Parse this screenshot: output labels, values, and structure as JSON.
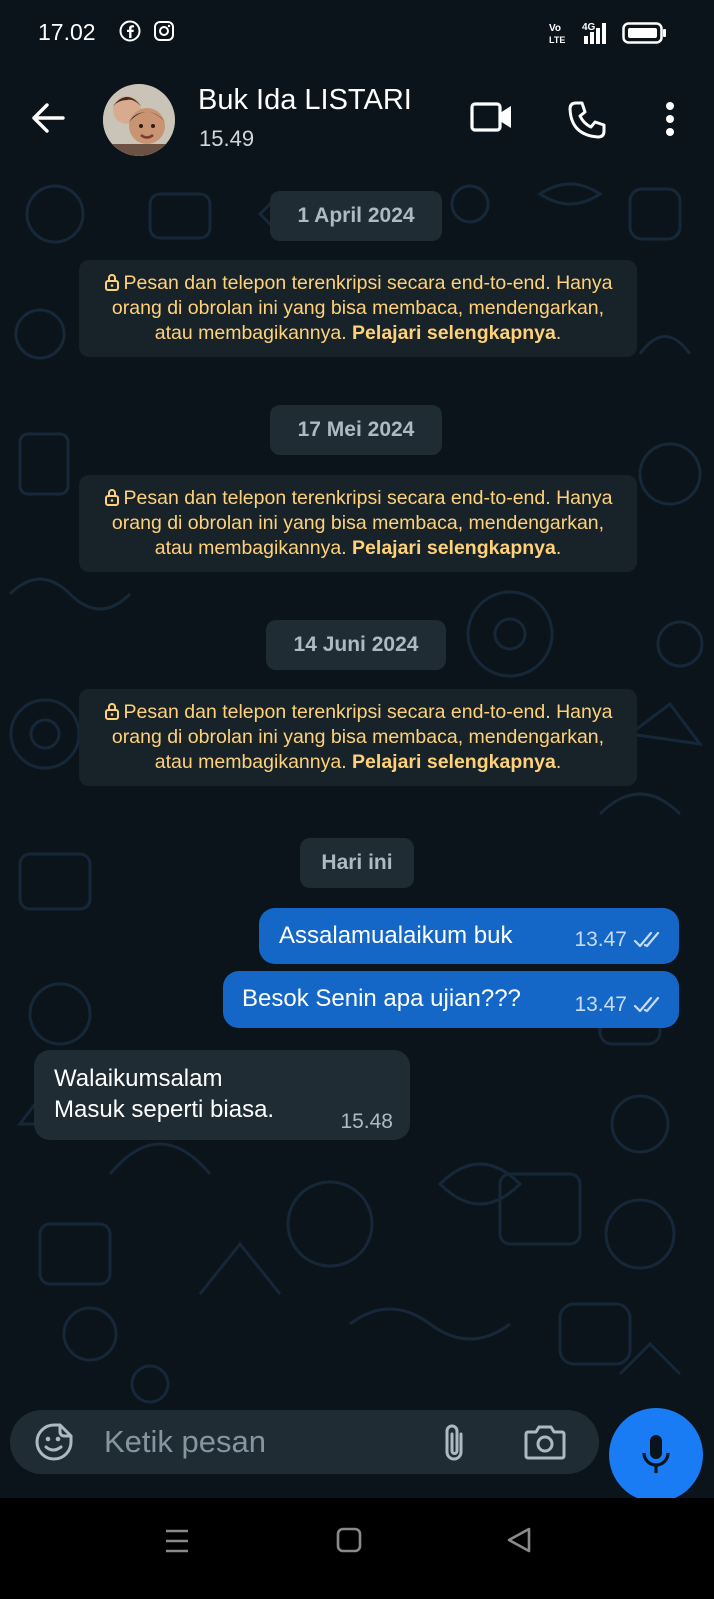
{
  "status_bar": {
    "time": "17.02",
    "icons": [
      "facebook-icon",
      "instagram-icon",
      "volte-icon",
      "signal-4g-icon",
      "battery-icon"
    ],
    "network_label": "4G",
    "volte_label": "Vo LTE"
  },
  "header": {
    "contact_name": "Buk Ida LISTARI",
    "last_seen": "15.49"
  },
  "chat": {
    "date_chips": [
      "1 April 2024",
      "17 Mei 2024",
      "14 Juni 2024",
      "Hari ini"
    ],
    "encryption_notice": {
      "text": "Pesan dan telepon terenkripsi secara end-to-end. Hanya orang di obrolan ini yang bisa membaca, mendengarkan, atau membagikannya.",
      "link": "Pelajari selengkapnya"
    },
    "messages": [
      {
        "direction": "outgoing",
        "text": "Assalamualaikum buk",
        "time": "13.47",
        "status": "read"
      },
      {
        "direction": "outgoing",
        "text": "Besok Senin apa ujian???",
        "time": "13.47",
        "status": "read"
      },
      {
        "direction": "incoming",
        "line1": "Walaikumsalam",
        "line2": "Masuk seperti biasa.",
        "time": "15.48"
      }
    ]
  },
  "composer": {
    "placeholder": "Ketik pesan"
  },
  "colors": {
    "background": "#0b141a",
    "outgoing_bubble": "#1467c7",
    "incoming_bubble": "#1f2c34",
    "notice_text": "#ffd279",
    "mic_button": "#1a7cf5"
  }
}
